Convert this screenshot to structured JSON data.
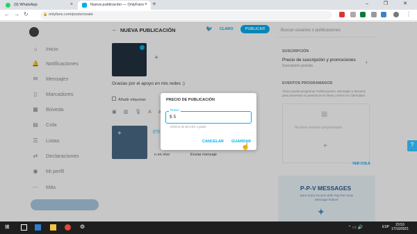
{
  "browser": {
    "tabs": [
      {
        "label": "(9) WhatsApp",
        "favicon_color": "#25d366"
      },
      {
        "label": "Nueva publicación — OnlyFans",
        "favicon_color": "#00aff0"
      }
    ],
    "new_tab_icon": "+",
    "window_controls": "– ❐ ✕",
    "url": "onlyfans.com/posts/create",
    "nav_icons": [
      "back-arrow-icon",
      "forward-arrow-icon",
      "reload-icon"
    ]
  },
  "sidebar": {
    "items": [
      {
        "label": "Inicio",
        "icon": "⌂"
      },
      {
        "label": "Notificaciones",
        "icon": "🔔"
      },
      {
        "label": "Mensajes",
        "icon": "✉"
      },
      {
        "label": "Marcadores",
        "icon": "▯"
      },
      {
        "label": "Bóveda",
        "icon": "▦"
      },
      {
        "label": "Cola",
        "icon": "▤"
      },
      {
        "label": "Listas",
        "icon": "☰"
      },
      {
        "label": "Declaraciones",
        "icon": "⇄"
      },
      {
        "label": "Mi perfil",
        "icon": "◉"
      },
      {
        "label": "Más",
        "icon": "⋯"
      }
    ]
  },
  "main": {
    "back_icon": "←",
    "title": "NUEVA PUBLICACIÓN",
    "claro_label": "CLARO",
    "publish_label": "PUBLICAR",
    "caption": "Gracias por el apoyo en mis redes :)",
    "tags_label": "Añadir etiquetas",
    "live_label": "n en vivo",
    "send_message_label": "Enviar mensaje"
  },
  "right": {
    "search_placeholder": "Buscar usuarios o publicaciones",
    "subscription_header": "SUSCRIPCIÓN",
    "subscription_title": "Precio de suscripción y promociones",
    "subscription_desc": "Suscripción gratuita",
    "events_header": "EVENTOS PROGRAMADOS",
    "events_desc": "Ahora puede programar Publicaciones, Mensajes y Streams para aumentar su presencia en línea y verlos en Calendario",
    "events_empty": "No tiene eventos programados",
    "view_queue": "VER COLA",
    "banner_title": "P-P-V MESSAGES",
    "banner_sub": "Earn Extra Income With Pay-Per-View Message feature"
  },
  "dialog": {
    "title": "PRECIO DE PUBLICACIÓN",
    "field_label": "Precio",
    "currency": "$",
    "value": "5",
    "hint": "Mínimo de $3 USD o gratis",
    "cancel_label": "CANCELAR",
    "save_label": "GUARDAR"
  },
  "taskbar": {
    "lang": "ESP",
    "time": "23:53",
    "date": "17/10/2021"
  },
  "colors": {
    "accent": "#00aff0"
  }
}
